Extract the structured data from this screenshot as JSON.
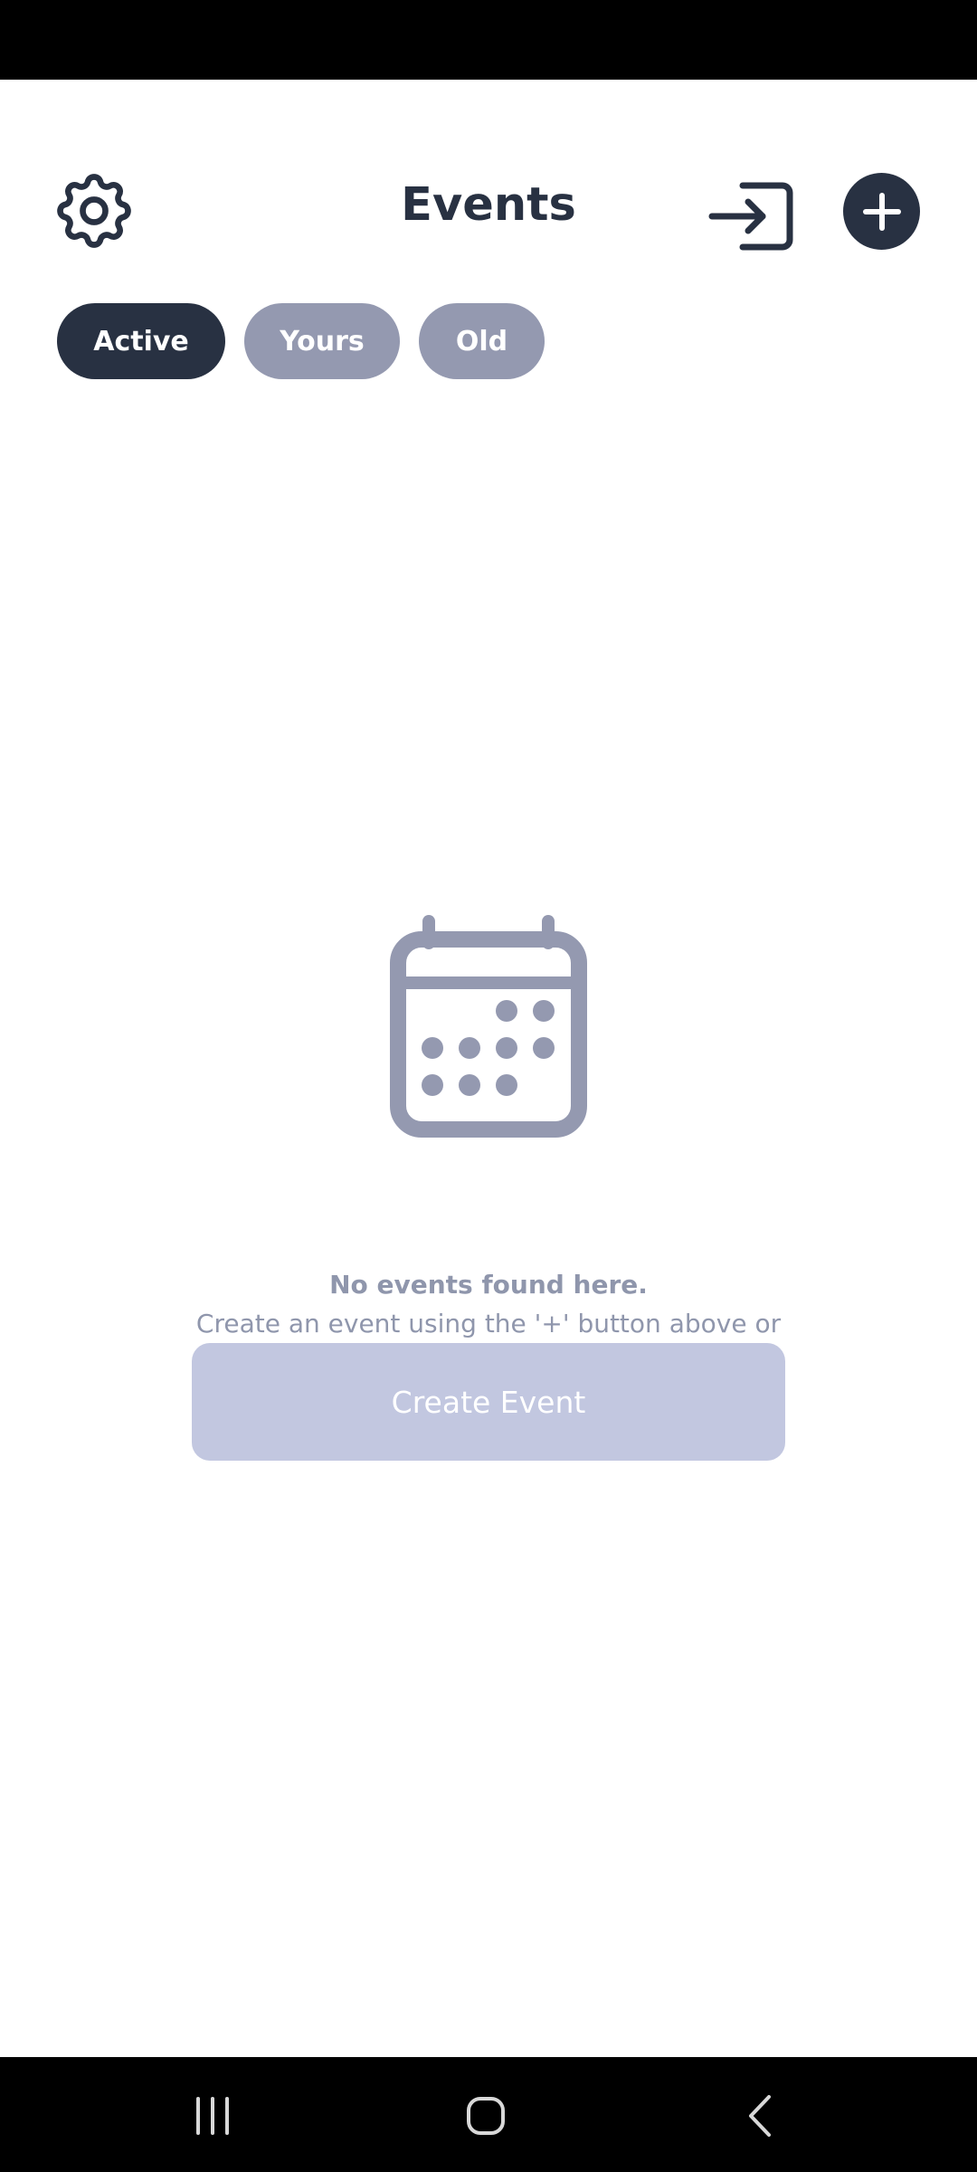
{
  "header": {
    "title": "Events",
    "settings_icon": "gear-icon",
    "signin_icon": "sign-in-icon",
    "add_icon": "plus-icon"
  },
  "tabs": [
    {
      "label": "Active",
      "active": true
    },
    {
      "label": "Yours",
      "active": false
    },
    {
      "label": "Old",
      "active": false
    }
  ],
  "empty_state": {
    "icon": "calendar-icon",
    "title": "No events found here.",
    "description": "Create an event using the '+' button above or this button.",
    "button_label": "Create Event"
  },
  "navigation": {
    "recents_icon": "recents-icon",
    "home_icon": "home-icon",
    "back_icon": "back-icon"
  },
  "colors": {
    "primary": "#283142",
    "inactive_tab": "#9499b0",
    "muted_text": "#8f96ac",
    "create_button": "#c2c7e0"
  }
}
